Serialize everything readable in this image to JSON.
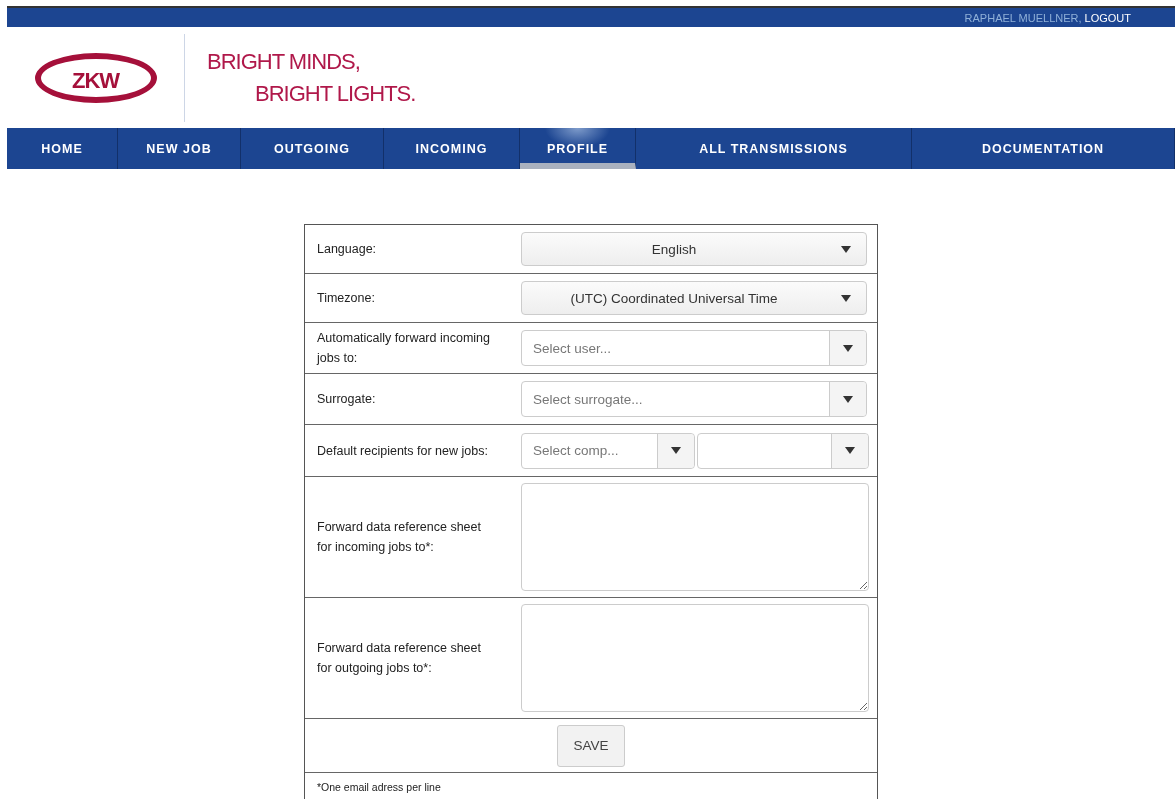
{
  "top_bar": {
    "user": "RAPHAEL MUELLNER,",
    "logout": "LOGOUT"
  },
  "header": {
    "logo": "ZKW",
    "slogan_1": "BRIGHT MINDS,",
    "slogan_2": "BRIGHT LIGHTS."
  },
  "nav": [
    {
      "label": "HOME",
      "selected": false
    },
    {
      "label": "NEW JOB",
      "selected": false
    },
    {
      "label": "OUTGOING",
      "selected": false
    },
    {
      "label": "INCOMING",
      "selected": false
    },
    {
      "label": "PROFILE",
      "selected": true
    },
    {
      "label": "ALL TRANSMISSIONS",
      "selected": false
    },
    {
      "label": "DOCUMENTATION",
      "selected": false
    }
  ],
  "form": {
    "rows": [
      {
        "label": "Language:",
        "kind": "select",
        "value": "English"
      },
      {
        "label": "Timezone:",
        "kind": "select",
        "value": "(UTC) Coordinated Universal Time"
      },
      {
        "label": "Automatically forward incoming jobs to:",
        "kind": "combo",
        "placeholder": "Select user..."
      },
      {
        "label": "Surrogate:",
        "kind": "combo",
        "placeholder": "Select surrogate..."
      },
      {
        "label": "Default recipients for new jobs:",
        "kind": "double",
        "placeholder": "Select comp..."
      },
      {
        "label": "Forward data reference sheet for incoming jobs to*:",
        "kind": "textarea"
      },
      {
        "label": "Forward data reference sheet for outgoing jobs to*:",
        "kind": "textarea"
      }
    ],
    "save": "SAVE",
    "note": "*One email adress per line"
  }
}
